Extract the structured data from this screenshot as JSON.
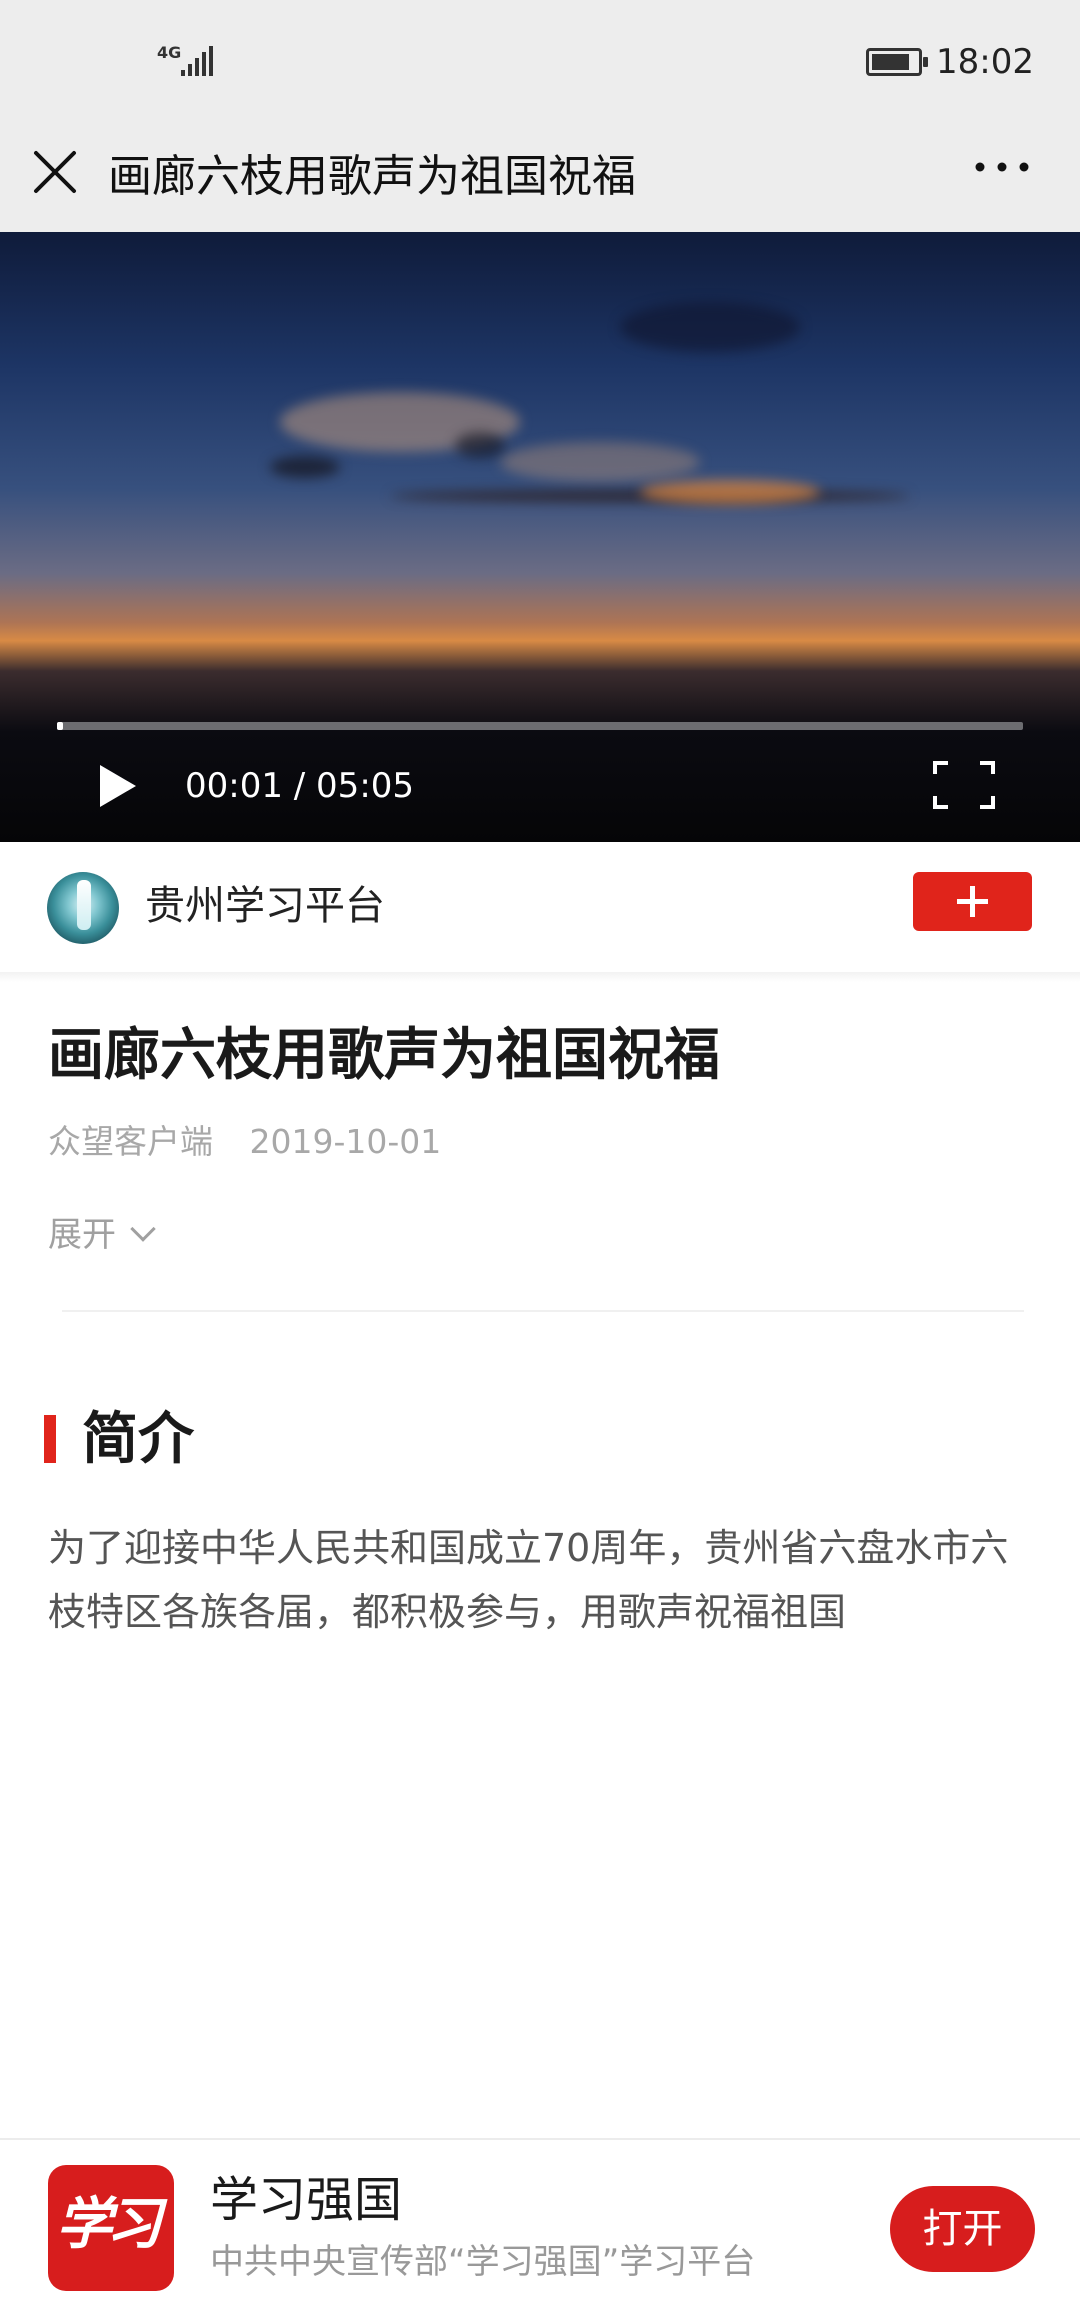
{
  "status_bar": {
    "network": "4G",
    "signal_level": 5,
    "battery_level": 0.85,
    "time": "18:02"
  },
  "nav": {
    "title": "画廊六枝用歌声为祖国祝福",
    "close_icon": "close-icon",
    "more_icon": "more-icon"
  },
  "video": {
    "current_time": "00:01",
    "duration": "05:05",
    "time_display": "00:01 / 05:05",
    "progress": 0.003,
    "play_icon": "play-icon",
    "fullscreen_icon": "fullscreen-icon"
  },
  "channel": {
    "name": "贵州学习平台",
    "avatar": "waterfall-avatar",
    "follow_icon": "plus-icon",
    "follow_color": "#e0241b"
  },
  "article": {
    "title": "画廊六枝用歌声为祖国祝福",
    "source": "众望客户端",
    "date": "2019-10-01",
    "expand_label": "展开"
  },
  "intro_section": {
    "heading": "简介",
    "text": "为了迎接中华人民共和国成立70周年，贵州省六盘水市六枝特区各族各届，都积极参与，用歌声祝福祖国",
    "marker_color": "#e0241b"
  },
  "app_banner": {
    "logo_text": "学习",
    "name": "学习强国",
    "description": "中共中央宣传部“学习强国”学习平台",
    "open_label": "打开",
    "brand_color": "#d71d1d"
  }
}
